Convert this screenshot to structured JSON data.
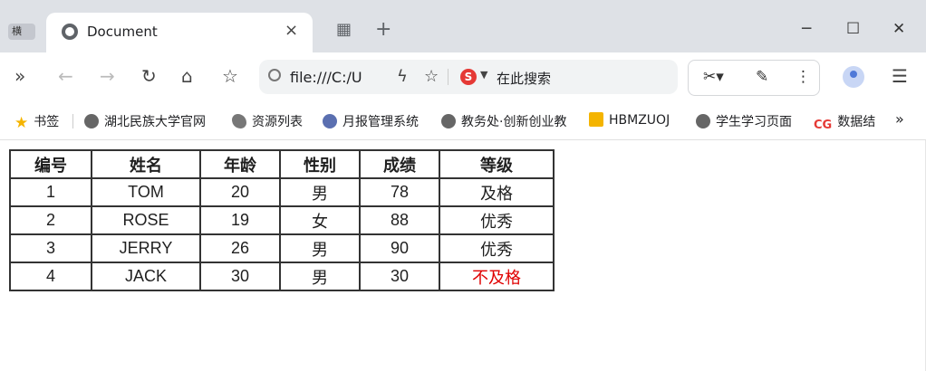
{
  "browser": {
    "side_button_label": "横",
    "tab": {
      "title": "Document",
      "favicon": "globe-icon",
      "close": "×"
    },
    "new_tab": "+",
    "address": "file:///C:/U",
    "search_placeholder": "在此搜索",
    "sogou_label": "S"
  },
  "bookmarks": [
    {
      "label": "书签",
      "icon": "star-icon"
    },
    {
      "label": "湖北民族大学官网",
      "icon": "globe-icon"
    },
    {
      "label": "资源列表",
      "icon": "leaf-icon"
    },
    {
      "label": "月报管理系统",
      "icon": "seal-icon"
    },
    {
      "label": "教务处·创新创业教",
      "icon": "globe-icon"
    },
    {
      "label": "HBMZUOJ",
      "icon": "hbmzuoj-icon"
    },
    {
      "label": "学生学习页面",
      "icon": "globe-icon"
    },
    {
      "label": "数据结",
      "icon": "cg-icon"
    }
  ],
  "table": {
    "headers": [
      "编号",
      "姓名",
      "年龄",
      "性别",
      "成绩",
      "等级"
    ],
    "rows": [
      [
        "1",
        "TOM",
        "20",
        "男",
        "78",
        "及格"
      ],
      [
        "2",
        "ROSE",
        "19",
        "女",
        "88",
        "优秀"
      ],
      [
        "3",
        "JERRY",
        "26",
        "男",
        "90",
        "优秀"
      ],
      [
        "4",
        "JACK",
        "30",
        "男",
        "30",
        "不及格"
      ]
    ]
  },
  "colors": {
    "fail": "#e00000",
    "tabstrip": "#dee1e6"
  }
}
